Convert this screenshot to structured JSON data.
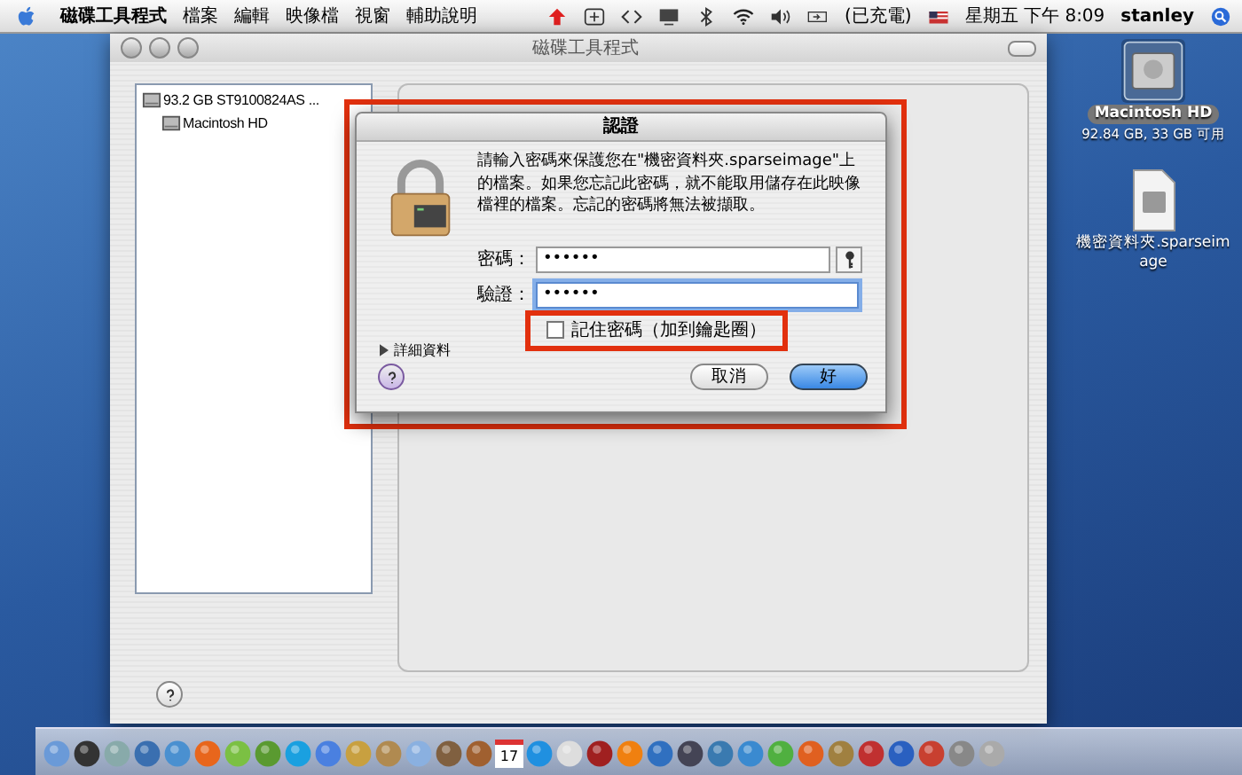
{
  "menubar": {
    "menus": [
      "磁碟工具程式",
      "檔案",
      "編輯",
      "映像檔",
      "視窗",
      "輔助說明"
    ],
    "battery_status": "(已充電)",
    "clock": "星期五 下午 8:09",
    "user": "stanley"
  },
  "window": {
    "title": "磁碟工具程式",
    "toolbar_shown": true,
    "disks": [
      {
        "label": "93.2 GB ST9100824AS ...",
        "selected": false,
        "children": [
          {
            "label": "Macintosh HD",
            "selected": false
          }
        ]
      }
    ]
  },
  "dialog": {
    "title": "認證",
    "message": "請輸入密碼來保護您在\"機密資料夾.sparseimage\"上的檔案。如果您忘記此密碼，就不能取用儲存在此映像檔裡的檔案。忘記的密碼將無法被擷取。",
    "fields": [
      {
        "label": "密碼：",
        "value": "••••••",
        "focused": false
      },
      {
        "label": "驗證：",
        "value": "••••••",
        "focused": true
      }
    ],
    "remember": {
      "label": "記住密碼（加到鑰匙圈）",
      "checked": false
    },
    "details": "詳細資料",
    "buttons": [
      {
        "label": "取消",
        "default": false
      },
      {
        "label": "好",
        "default": true
      }
    ]
  },
  "desktop": [
    {
      "label": "Macintosh HD",
      "sublabel": "92.84 GB, 33 GB 可用",
      "kind": "disk"
    },
    {
      "label": "機密資料夾.sparseimage",
      "kind": "file"
    }
  ],
  "dock": {
    "calendar_day": "17"
  }
}
